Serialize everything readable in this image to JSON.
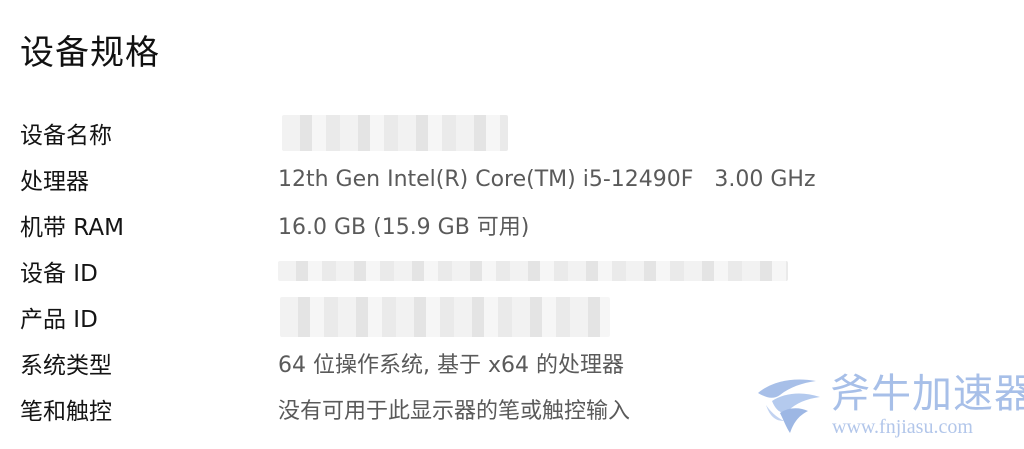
{
  "section_title": "设备规格",
  "specs": [
    {
      "label": "设备名称",
      "value": ""
    },
    {
      "label": "处理器",
      "value": "12th Gen Intel(R) Core(TM) i5-12490F   3.00 GHz"
    },
    {
      "label": "机带 RAM",
      "value": "16.0 GB (15.9 GB 可用)"
    },
    {
      "label": "设备 ID",
      "value": ""
    },
    {
      "label": "产品 ID",
      "value": ""
    },
    {
      "label": "系统类型",
      "value": "64 位操作系统, 基于 x64 的处理器"
    },
    {
      "label": "笔和触控",
      "value": "没有可用于此显示器的笔或触控输入"
    }
  ],
  "watermark": {
    "name": "斧牛加速器",
    "url": "www.fnjiasu.com",
    "color": "#a7bfe8"
  }
}
